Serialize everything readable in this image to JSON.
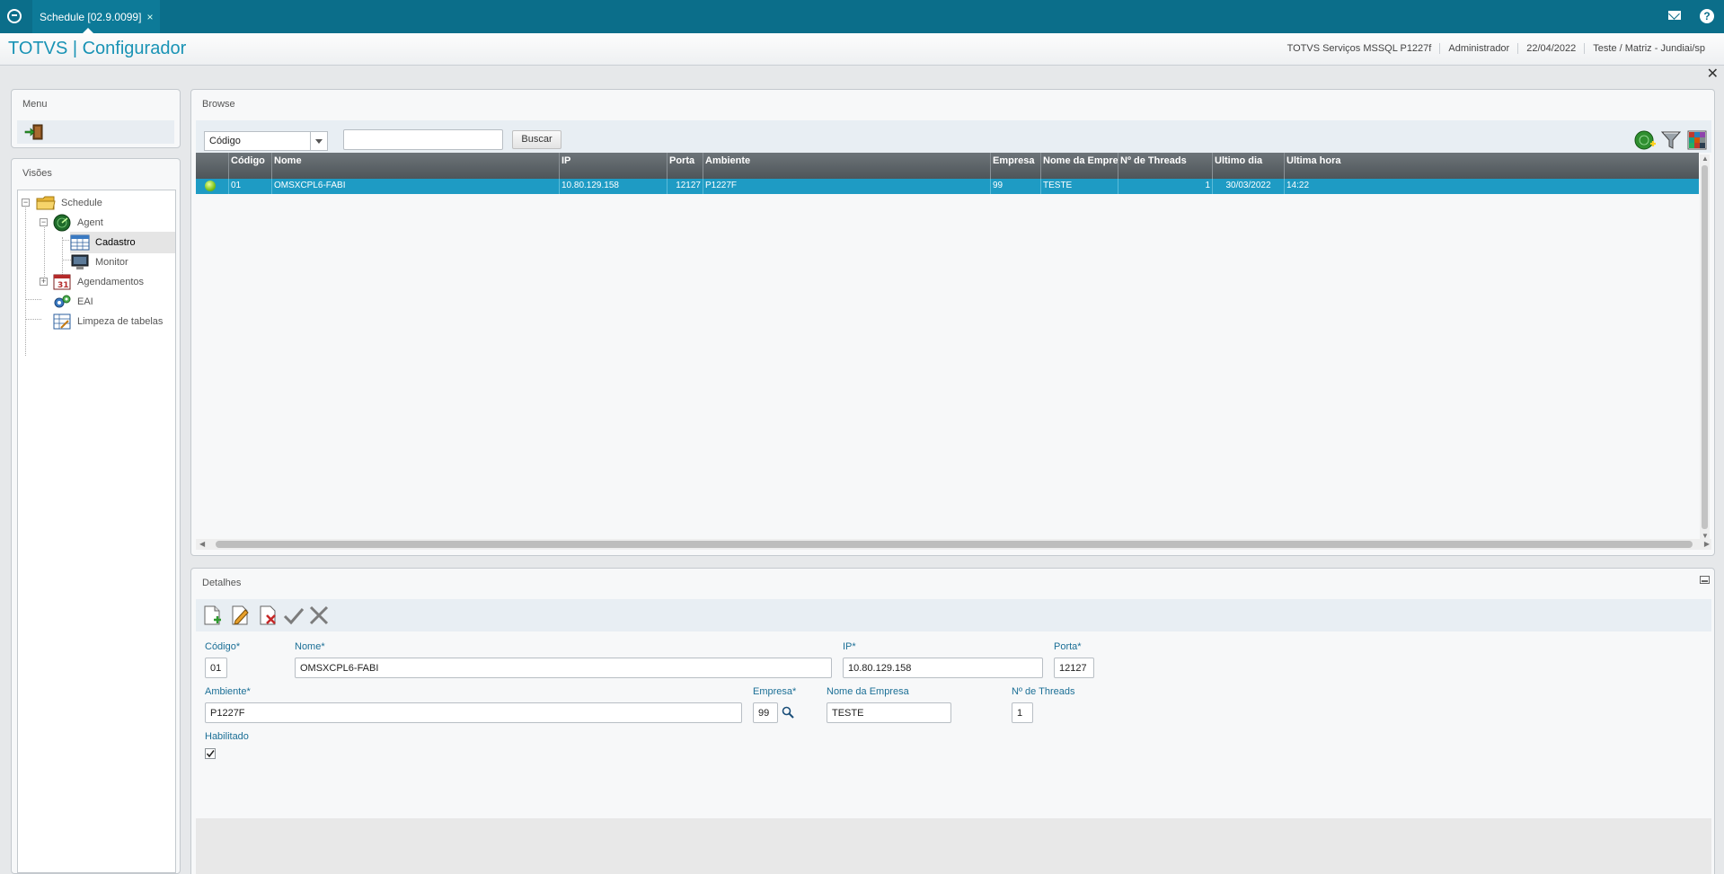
{
  "topbar": {
    "tab_label": "Schedule [02.9.0099]",
    "tab_close": "×"
  },
  "header": {
    "title": "TOTVS | Configurador",
    "server": "TOTVS Serviços MSSQL P1227f",
    "user": "Administrador",
    "date": "22/04/2022",
    "branch": "Teste / Matriz - Jundiai/sp"
  },
  "menu": {
    "title": "Menu"
  },
  "visoes": {
    "title": "Visões",
    "tree": {
      "schedule": "Schedule",
      "agent": "Agent",
      "cadastro": "Cadastro",
      "monitor": "Monitor",
      "agendamentos": "Agendamentos",
      "eai": "EAI",
      "limpeza": "Limpeza de tabelas"
    }
  },
  "browse": {
    "title": "Browse",
    "search_select": "Código",
    "search_button": "Buscar",
    "columns": {
      "codigo": "Código",
      "nome": "Nome",
      "ip": "IP",
      "porta": "Porta",
      "ambiente": "Ambiente",
      "empresa": "Empresa",
      "nome_empresa": "Nome da Empresa",
      "threads": "Nº de Threads",
      "ultimo_dia": "Ultimo dia",
      "ultima_hora": "Ultima hora"
    },
    "rows": [
      {
        "codigo": "01",
        "nome": "OMSXCPL6-FABI",
        "ip": "10.80.129.158",
        "porta": "12127",
        "ambiente": "P1227F",
        "empresa": "99",
        "nome_empresa": "TESTE",
        "threads": "1",
        "ultimo_dia": "30/03/2022",
        "ultima_hora": "14:22"
      }
    ]
  },
  "detalhes": {
    "title": "Detalhes",
    "labels": {
      "codigo": "Código*",
      "nome": "Nome*",
      "ip": "IP*",
      "porta": "Porta*",
      "ambiente": "Ambiente*",
      "empresa": "Empresa*",
      "nome_empresa": "Nome da Empresa",
      "threads": "Nº de Threads",
      "habilitado": "Habilitado"
    },
    "values": {
      "codigo": "01",
      "nome": "OMSXCPL6-FABI",
      "ip": "10.80.129.158",
      "porta": "12127",
      "ambiente": "P1227F",
      "empresa": "99",
      "nome_empresa": "TESTE",
      "threads": "1",
      "habilitado": true
    }
  },
  "colors": {
    "topbar": "#0b6e8a",
    "accent": "#1993b5",
    "selection": "#1e9bc4",
    "label": "#1b6f96"
  }
}
